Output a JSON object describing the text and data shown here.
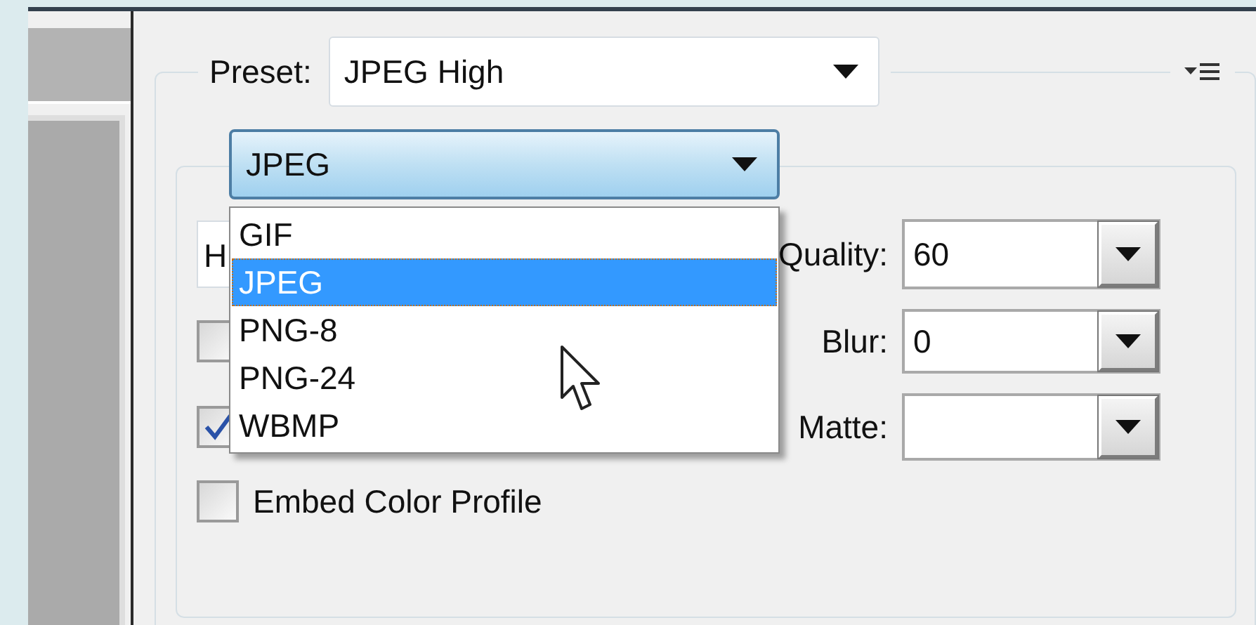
{
  "preset": {
    "label": "Preset:",
    "value": "JPEG High"
  },
  "format": {
    "value": "JPEG",
    "expanded": true,
    "options": [
      {
        "label": "GIF",
        "selected": false
      },
      {
        "label": "JPEG",
        "selected": true
      },
      {
        "label": "PNG-8",
        "selected": false
      },
      {
        "label": "PNG-24",
        "selected": false
      },
      {
        "label": "WBMP",
        "selected": false
      }
    ]
  },
  "compression": {
    "value": "H"
  },
  "settings": [
    {
      "label": "Quality:",
      "value": "60"
    },
    {
      "label": "Blur:",
      "value": "0"
    },
    {
      "label": "Matte:"
    }
  ],
  "checkboxes": [
    {
      "checked": false
    },
    {
      "checked": true
    },
    {
      "label": "Embed Color Profile",
      "checked": false
    }
  ]
}
